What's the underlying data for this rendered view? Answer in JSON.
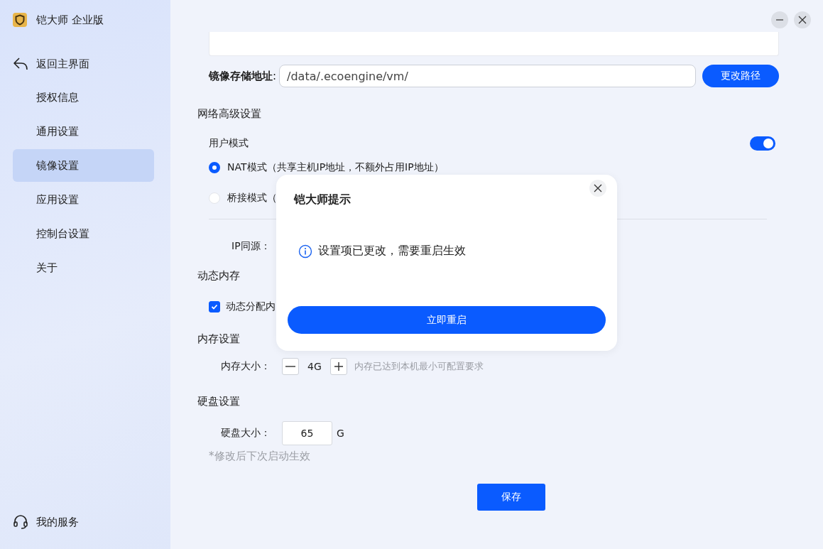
{
  "app": {
    "title": "铠大师 企业版"
  },
  "sidebar": {
    "back": "返回主界面",
    "items": [
      {
        "label": "授权信息",
        "selected": false
      },
      {
        "label": "通用设置",
        "selected": false
      },
      {
        "label": "镜像设置",
        "selected": true
      },
      {
        "label": "应用设置",
        "selected": false
      },
      {
        "label": "控制台设置",
        "selected": false
      },
      {
        "label": "关于",
        "selected": false
      }
    ],
    "service": "我的服务"
  },
  "image_path": {
    "label": "镜像存储地址",
    "colon": ":",
    "value": "/data/.ecoengine/vm/",
    "button": "更改路径"
  },
  "network": {
    "heading": "网络高级设置",
    "user_mode": {
      "label": "用户模式",
      "on": true
    },
    "modes": [
      {
        "label": "NAT模式（共享主机IP地址，不额外占用IP地址）",
        "selected": true
      },
      {
        "label": "桥接模式（",
        "selected": false
      }
    ],
    "ip_source": "IP同源："
  },
  "dynamic_memory": {
    "heading": "动态内存",
    "option": {
      "label": "动态分配内",
      "checked": true
    }
  },
  "memory": {
    "heading": "内存设置",
    "label": "内存大小：",
    "value": "4G",
    "hint": "内存已达到本机最小可配置要求"
  },
  "disk": {
    "heading": "硬盘设置",
    "label": "硬盘大小：",
    "value": "65",
    "unit": "G",
    "note": "*修改后下次启动生效"
  },
  "save": "保存",
  "dialog": {
    "title": "铠大师提示",
    "message": "设置项已更改，需要重启生效",
    "button": "立即重启"
  }
}
